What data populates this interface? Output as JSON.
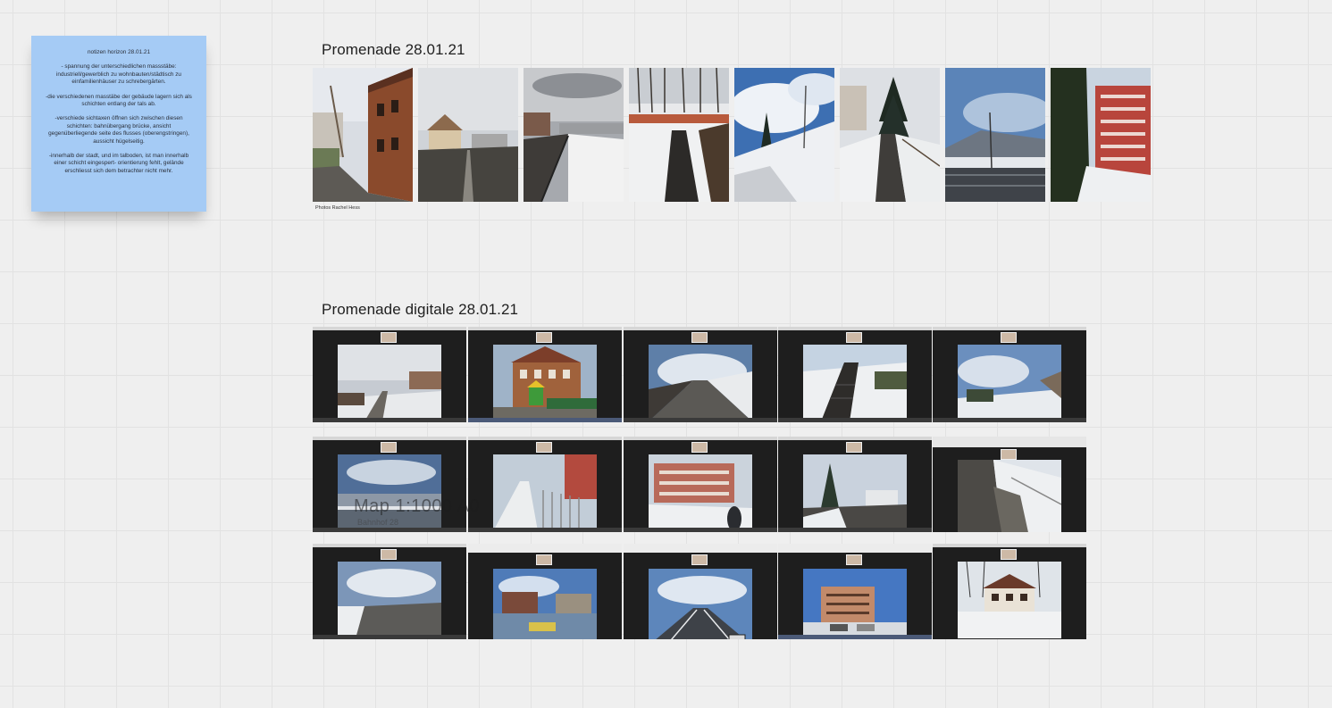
{
  "sticky_note": {
    "title": "notizen horizon 28.01.21",
    "paragraphs": [
      "- spannung der unterschiedlichen massstäbe: industriell/gewerblich zu wohnbauten/städtisch zu einfamilienhäuser zu schrebergärten.",
      "-die verschiedenen masstäbe der gebäude lagern sich als schichten entlang der tals ab.",
      "-verschiede sichtaxen öffnen sich zwischen diesen schichten: bahnübergang brücke, ansicht gegenüberliegende seite des flusses (oberengstringen), aussicht hügelseitig.",
      "-innerhalb der stadt, und im talboden, ist man innerhalb einer schicht eingespert- orientierung fehlt, gelände erschliesst sich dem betrachter nicht mehr."
    ]
  },
  "section1": {
    "title": "Promenade 28.01.21",
    "caption": "Photos Rachel Hess"
  },
  "section2": {
    "title": "Promenade digitale 28.01.21"
  },
  "overlay": {
    "text": "Map 1:1000 A0",
    "sub": "Bahnhof 28"
  }
}
